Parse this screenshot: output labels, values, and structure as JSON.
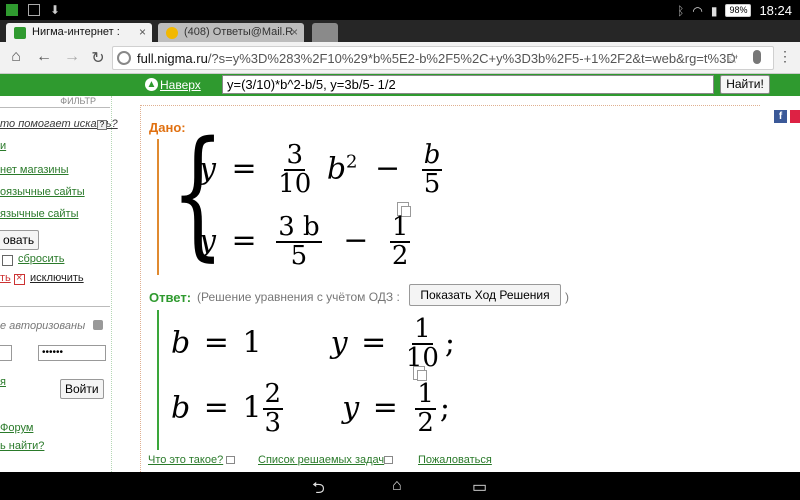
{
  "status_bar": {
    "time": "18:24",
    "battery": "98%"
  },
  "tabs": [
    {
      "title": "Нигма-интернет :",
      "close": "×"
    },
    {
      "title": "(408) Ответы@Mail.R",
      "close": "×"
    }
  ],
  "omnibox": {
    "host": "full.nigma.ru",
    "path": "/?s=y%3D%283%2F10%29*b%5E2-b%2F5%2C+y%3D3b%2F5-+1%2F2&t=web&rg=t%3D%D"
  },
  "search": {
    "up_label": "Наверх",
    "query": "y=(3/10)*b^2-b/5, y=3b/5- 1/2",
    "submit_label": "Найти!"
  },
  "sidebar": {
    "filter_head": "ФИЛЬТР",
    "help_link": "то помогает искать?",
    "help_mark": "?",
    "links": [
      "и",
      "нет магазины",
      "оязычные сайты",
      "язычные сайты"
    ],
    "apply_label": "овать",
    "reset_label": "сбросить",
    "exclude_prefix": "ть",
    "exclude_label": "исключить",
    "auth_text": "е авторизованы",
    "password_value": "••••••",
    "login_label": "Войти",
    "link_a": "я",
    "link_forum": "Форум",
    "link_forgot": "ь найти?"
  },
  "main": {
    "given_label": "Дано:",
    "answer_label": "Ответ:",
    "answer_note": "(Решение уравнения с учётом ОДЗ :",
    "show_steps_label": "Показать Ход Решения",
    "answer_note_close": ")",
    "eq1": {
      "lhs": "y",
      "eq": "=",
      "f1_num": "3",
      "f1_den": "10",
      "var": "b",
      "pow": "2",
      "minus": "−",
      "f2_num": "b",
      "f2_den": "5"
    },
    "eq2": {
      "lhs": "y",
      "eq": "=",
      "f1_num": "3 b",
      "f1_den": "5",
      "minus": "−",
      "f2_num": "1",
      "f2_den": "2"
    },
    "sol1": {
      "b": "b",
      "eq": "=",
      "b_val": "1",
      "y": "y",
      "y_num": "1",
      "y_den": "10",
      "sep": ";"
    },
    "sol2": {
      "b": "b",
      "eq": "=",
      "b_whole": "1",
      "b_num": "2",
      "b_den": "3",
      "y": "y",
      "y_num": "1",
      "y_den": "2",
      "sep": ";"
    }
  },
  "footer": {
    "what_is_it": "Что это такое?",
    "task_list": "Список решаемых задач",
    "complain": "Пожаловаться"
  },
  "share": {
    "fb": "f"
  }
}
